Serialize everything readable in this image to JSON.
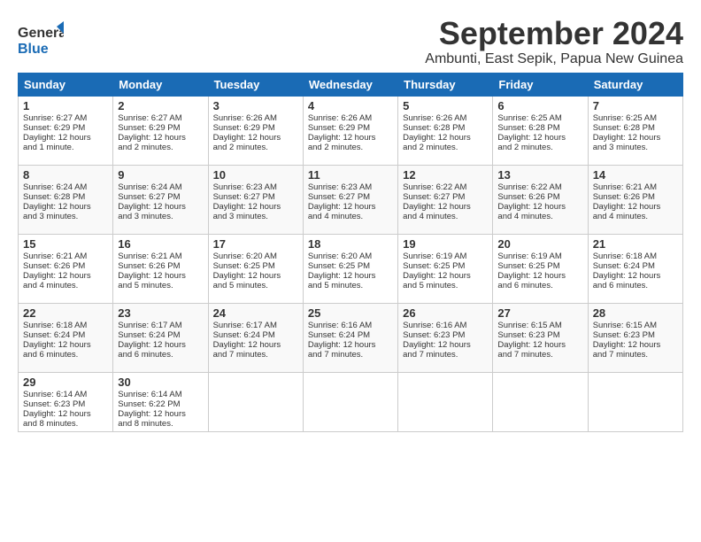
{
  "logo": {
    "line1": "General",
    "line2": "Blue"
  },
  "title": "September 2024",
  "location": "Ambunti, East Sepik, Papua New Guinea",
  "weekdays": [
    "Sunday",
    "Monday",
    "Tuesday",
    "Wednesday",
    "Thursday",
    "Friday",
    "Saturday"
  ],
  "weeks": [
    [
      {
        "day": "1",
        "sunrise": "6:27 AM",
        "sunset": "6:29 PM",
        "daylight": "12 hours and 1 minute."
      },
      {
        "day": "2",
        "sunrise": "6:27 AM",
        "sunset": "6:29 PM",
        "daylight": "12 hours and 2 minutes."
      },
      {
        "day": "3",
        "sunrise": "6:26 AM",
        "sunset": "6:29 PM",
        "daylight": "12 hours and 2 minutes."
      },
      {
        "day": "4",
        "sunrise": "6:26 AM",
        "sunset": "6:29 PM",
        "daylight": "12 hours and 2 minutes."
      },
      {
        "day": "5",
        "sunrise": "6:26 AM",
        "sunset": "6:28 PM",
        "daylight": "12 hours and 2 minutes."
      },
      {
        "day": "6",
        "sunrise": "6:25 AM",
        "sunset": "6:28 PM",
        "daylight": "12 hours and 2 minutes."
      },
      {
        "day": "7",
        "sunrise": "6:25 AM",
        "sunset": "6:28 PM",
        "daylight": "12 hours and 3 minutes."
      }
    ],
    [
      {
        "day": "8",
        "sunrise": "6:24 AM",
        "sunset": "6:28 PM",
        "daylight": "12 hours and 3 minutes."
      },
      {
        "day": "9",
        "sunrise": "6:24 AM",
        "sunset": "6:27 PM",
        "daylight": "12 hours and 3 minutes."
      },
      {
        "day": "10",
        "sunrise": "6:23 AM",
        "sunset": "6:27 PM",
        "daylight": "12 hours and 3 minutes."
      },
      {
        "day": "11",
        "sunrise": "6:23 AM",
        "sunset": "6:27 PM",
        "daylight": "12 hours and 4 minutes."
      },
      {
        "day": "12",
        "sunrise": "6:22 AM",
        "sunset": "6:27 PM",
        "daylight": "12 hours and 4 minutes."
      },
      {
        "day": "13",
        "sunrise": "6:22 AM",
        "sunset": "6:26 PM",
        "daylight": "12 hours and 4 minutes."
      },
      {
        "day": "14",
        "sunrise": "6:21 AM",
        "sunset": "6:26 PM",
        "daylight": "12 hours and 4 minutes."
      }
    ],
    [
      {
        "day": "15",
        "sunrise": "6:21 AM",
        "sunset": "6:26 PM",
        "daylight": "12 hours and 4 minutes."
      },
      {
        "day": "16",
        "sunrise": "6:21 AM",
        "sunset": "6:26 PM",
        "daylight": "12 hours and 5 minutes."
      },
      {
        "day": "17",
        "sunrise": "6:20 AM",
        "sunset": "6:25 PM",
        "daylight": "12 hours and 5 minutes."
      },
      {
        "day": "18",
        "sunrise": "6:20 AM",
        "sunset": "6:25 PM",
        "daylight": "12 hours and 5 minutes."
      },
      {
        "day": "19",
        "sunrise": "6:19 AM",
        "sunset": "6:25 PM",
        "daylight": "12 hours and 5 minutes."
      },
      {
        "day": "20",
        "sunrise": "6:19 AM",
        "sunset": "6:25 PM",
        "daylight": "12 hours and 6 minutes."
      },
      {
        "day": "21",
        "sunrise": "6:18 AM",
        "sunset": "6:24 PM",
        "daylight": "12 hours and 6 minutes."
      }
    ],
    [
      {
        "day": "22",
        "sunrise": "6:18 AM",
        "sunset": "6:24 PM",
        "daylight": "12 hours and 6 minutes."
      },
      {
        "day": "23",
        "sunrise": "6:17 AM",
        "sunset": "6:24 PM",
        "daylight": "12 hours and 6 minutes."
      },
      {
        "day": "24",
        "sunrise": "6:17 AM",
        "sunset": "6:24 PM",
        "daylight": "12 hours and 7 minutes."
      },
      {
        "day": "25",
        "sunrise": "6:16 AM",
        "sunset": "6:24 PM",
        "daylight": "12 hours and 7 minutes."
      },
      {
        "day": "26",
        "sunrise": "6:16 AM",
        "sunset": "6:23 PM",
        "daylight": "12 hours and 7 minutes."
      },
      {
        "day": "27",
        "sunrise": "6:15 AM",
        "sunset": "6:23 PM",
        "daylight": "12 hours and 7 minutes."
      },
      {
        "day": "28",
        "sunrise": "6:15 AM",
        "sunset": "6:23 PM",
        "daylight": "12 hours and 7 minutes."
      }
    ],
    [
      {
        "day": "29",
        "sunrise": "6:14 AM",
        "sunset": "6:23 PM",
        "daylight": "12 hours and 8 minutes."
      },
      {
        "day": "30",
        "sunrise": "6:14 AM",
        "sunset": "6:22 PM",
        "daylight": "12 hours and 8 minutes."
      },
      null,
      null,
      null,
      null,
      null
    ]
  ]
}
